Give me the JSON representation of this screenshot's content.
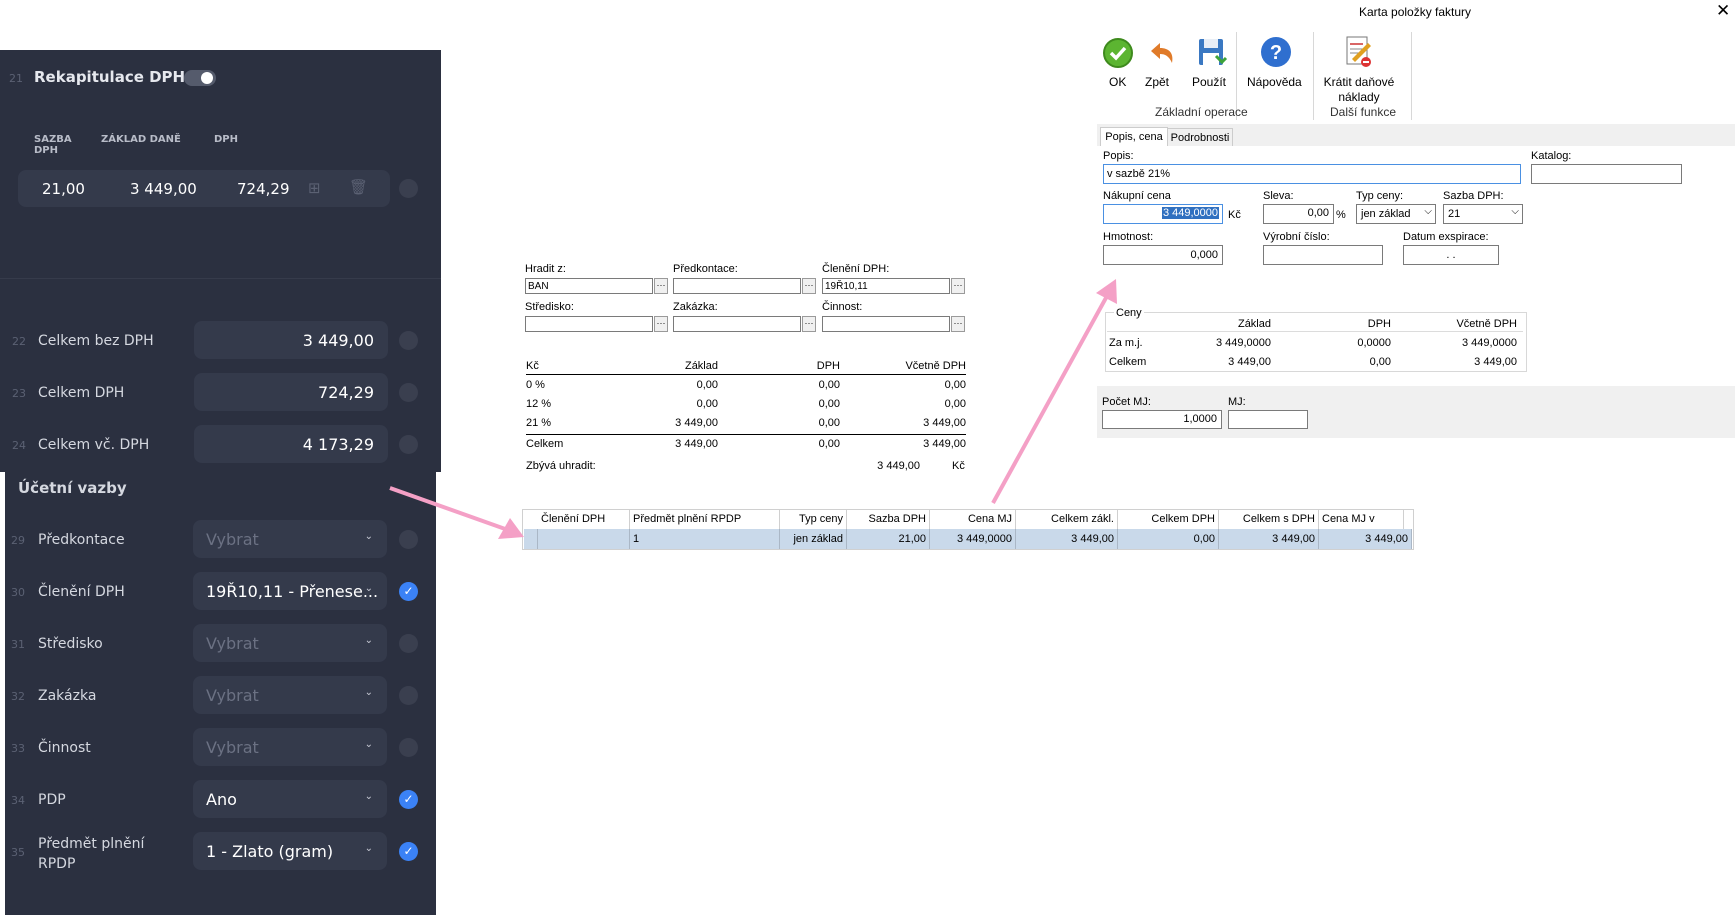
{
  "left_panel": {
    "recap": {
      "num": "21",
      "title": "Rekapitulace DPH"
    },
    "headers": {
      "rate": "SAZBA\nDPH",
      "base": "ZÁKLAD DANĚ",
      "vat": "DPH"
    },
    "row": {
      "rate": "21,00",
      "base": "3 449,00",
      "vat": "724,29"
    },
    "totals": [
      {
        "num": "22",
        "label": "Celkem bez DPH",
        "value": "3 449,00"
      },
      {
        "num": "23",
        "label": "Celkem DPH",
        "value": "724,29"
      },
      {
        "num": "24",
        "label": "Celkem vč. DPH",
        "value": "4 173,29"
      }
    ],
    "section_title": "Účetní vazby",
    "fields": [
      {
        "num": "29",
        "label": "Předkontace",
        "value": "Vybrat",
        "filled": false
      },
      {
        "num": "30",
        "label": "Členění DPH",
        "value": "19Ř10,11 - Přenese...",
        "filled": true
      },
      {
        "num": "31",
        "label": "Středisko",
        "value": "Vybrat",
        "filled": false
      },
      {
        "num": "32",
        "label": "Zakázka",
        "value": "Vybrat",
        "filled": false
      },
      {
        "num": "33",
        "label": "Činnost",
        "value": "Vybrat",
        "filled": false
      },
      {
        "num": "34",
        "label": "PDP",
        "value": "Ano",
        "filled": true
      },
      {
        "num": "35",
        "label": "Předmět plnění\nRPDP",
        "value": "1 - Zlato (gram)",
        "filled": true
      }
    ]
  },
  "middle": {
    "hradit_label": "Hradit z:",
    "hradit_value": "BAN",
    "predkontace_label": "Předkontace:",
    "predkontace_value": "",
    "cleneni_label": "Členění DPH:",
    "cleneni_value": "19Ř10,11",
    "stredisko_label": "Středisko:",
    "zakazka_label": "Zakázka:",
    "cinnost_label": "Činnost:",
    "table_headers": [
      "Kč",
      "Základ",
      "DPH",
      "Včetně DPH"
    ],
    "table_rows": [
      [
        "0 %",
        "0,00",
        "0,00",
        "0,00"
      ],
      [
        "12 %",
        "0,00",
        "0,00",
        "0,00"
      ],
      [
        "21 %",
        "3 449,00",
        "0,00",
        "3 449,00"
      ],
      [
        "Celkem",
        "3 449,00",
        "0,00",
        "3 449,00"
      ]
    ],
    "remaining_label": "Zbývá uhradit:",
    "remaining_value": "3 449,00",
    "remaining_currency": "Kč"
  },
  "grid": {
    "headers": [
      "Členění DPH",
      "Předmět plnění RPDP",
      "Typ ceny",
      "Sazba DPH",
      "Cena MJ",
      "Celkem zákl.",
      "Celkem DPH",
      "Celkem s DPH",
      "Cena MJ v měně"
    ],
    "row": [
      "",
      "1",
      "jen základ",
      "21,00",
      "3 449,0000",
      "3 449,00",
      "0,00",
      "3 449,00",
      "3 449,00"
    ]
  },
  "dialog": {
    "title": "Karta položky faktury",
    "toolbar": {
      "ok": "OK",
      "back": "Zpět",
      "apply": "Použít",
      "help": "Nápověda",
      "cut": "Krátit daňové\nnáklady",
      "group1": "Základní operace",
      "group2": "Další funkce"
    },
    "tabs": [
      "Popis, cena",
      "Podrobnosti"
    ],
    "popis_label": "Popis:",
    "popis_value": "v sazbě 21%",
    "katalog_label": "Katalog:",
    "katalog_value": "",
    "nakupni_label": "Nákupní cena",
    "nakupni_value": "3 449,0000",
    "nakupni_unit": "Kč",
    "sleva_label": "Sleva:",
    "sleva_value": "0,00",
    "sleva_unit": "%",
    "typ_label": "Typ ceny:",
    "typ_value": "jen základ",
    "sazba_label": "Sazba DPH:",
    "sazba_value": "21",
    "hmotnost_label": "Hmotnost:",
    "hmotnost_value": "0,000",
    "vyrobni_label": "Výrobní číslo:",
    "vyrobni_value": "",
    "datum_label": "Datum exspirace:",
    "datum_value": ". .",
    "ceny": {
      "title": "Ceny",
      "headers": [
        "",
        "Základ",
        "DPH",
        "Včetně DPH"
      ],
      "rows": [
        [
          "Za m.j.",
          "3 449,0000",
          "0,0000",
          "3 449,0000"
        ],
        [
          "Celkem",
          "3 449,00",
          "0,00",
          "3 449,00"
        ]
      ]
    },
    "pocet_label": "Počet MJ:",
    "pocet_value": "1,0000",
    "mj_label": "MJ:",
    "mj_value": ""
  },
  "colors": {
    "dark_bg": "#2b3040",
    "field_bg": "#343a4b",
    "accent_blue": "#3b82f6",
    "arrow_pink": "#f4a0c6",
    "grid_selected": "#c9d9ea"
  }
}
